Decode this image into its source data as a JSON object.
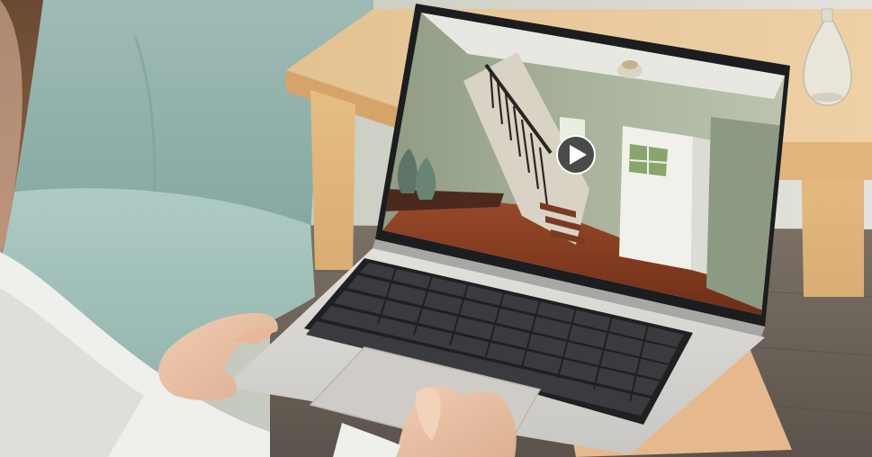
{
  "scene": {
    "type": "photograph",
    "subject": "laptop-on-lap-virtual-tour",
    "has_visible_text": false
  },
  "screen": {
    "content": "interior-staircase-photo",
    "overlay_icon": "play-icon",
    "play_button_color": "#4a4a4a",
    "play_triangle_color": "#ffffff"
  },
  "colors": {
    "wall": "#c9cdbf",
    "sofa": "#a5c3bd",
    "table": "#e5c397",
    "floor": "#6b6257",
    "laptop": "#d8d6d2",
    "keys": "#2d2e30",
    "skin": "#eac3a6",
    "shirt": "#efefec"
  }
}
